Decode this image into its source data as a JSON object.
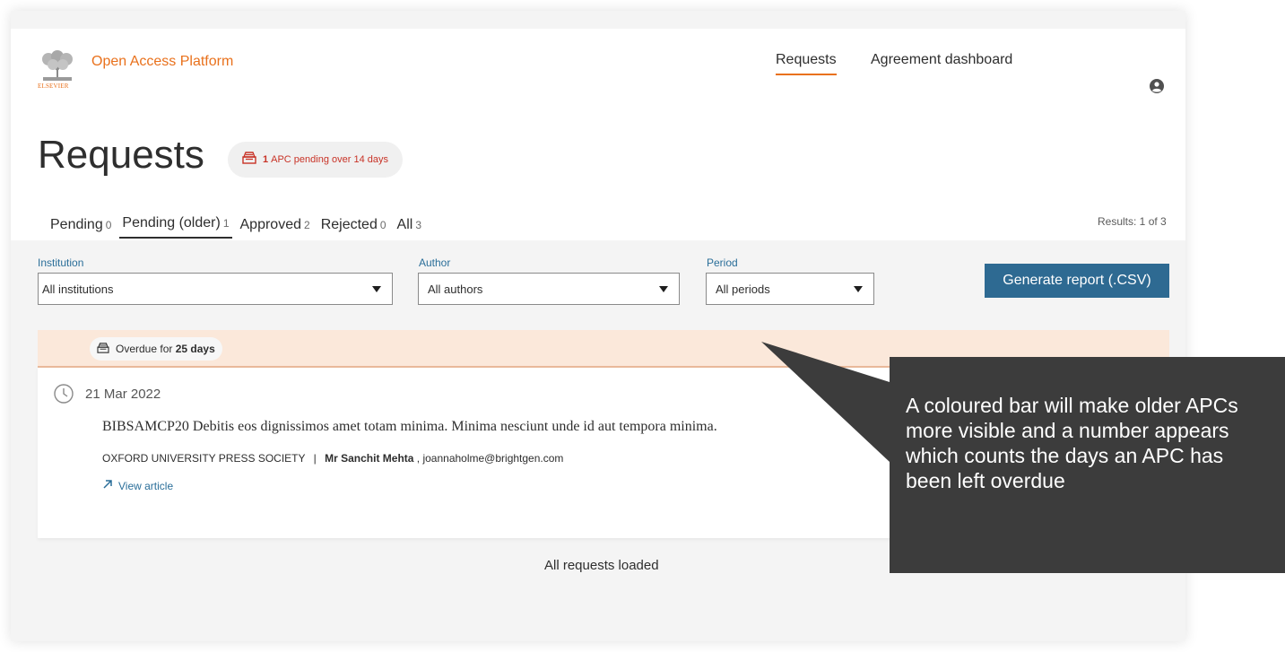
{
  "header": {
    "logo_text": "ELSEVIER",
    "brand": "Open Access Platform",
    "nav": [
      {
        "label": "Requests"
      },
      {
        "label": "Agreement dashboard"
      }
    ],
    "user_icon": "user-circle-icon"
  },
  "page": {
    "title": "Requests",
    "pending_badge": {
      "count": "1",
      "text": "APC pending over 14 days",
      "icon": "inbox-tray-icon"
    },
    "tabs": [
      {
        "label": "Pending",
        "count": "0"
      },
      {
        "label": "Pending (older)",
        "count": "1"
      },
      {
        "label": "Approved",
        "count": "2"
      },
      {
        "label": "Rejected",
        "count": "0"
      },
      {
        "label": "All",
        "count": "3"
      }
    ],
    "results": "Results: 1 of 3"
  },
  "filters": {
    "institution": {
      "label": "Institution",
      "value": "All institutions"
    },
    "author": {
      "label": "Author",
      "value": "All authors"
    },
    "period": {
      "label": "Period",
      "value": "All periods"
    },
    "generate_button": "Generate report (.CSV)"
  },
  "request": {
    "overdue_prefix": "Overdue for",
    "overdue_days": "25 days",
    "date": "21 Mar 2022",
    "title": "BIBSAMCP20 Debitis eos dignissimos amet totam minima. Minima nesciunt unde id aut tempora minima.",
    "publisher": "OXFORD UNIVERSITY PRESS SOCIETY",
    "separator": "|",
    "author": "Mr Sanchit Mehta",
    "email": ", joannaholme@brightgen.com",
    "view_link": "View article"
  },
  "footer": {
    "loaded": "All requests loaded"
  },
  "callout": {
    "text": "A coloured bar will make older APCs more visible and a number appears which counts the days an APC has been left overdue",
    "color": "#3c3c3c"
  },
  "colors": {
    "brand": "#e9711c",
    "alert": "#c83226",
    "link": "#2a6e99",
    "button": "#2e6a92",
    "overdue_bar": "#fbe8da"
  }
}
